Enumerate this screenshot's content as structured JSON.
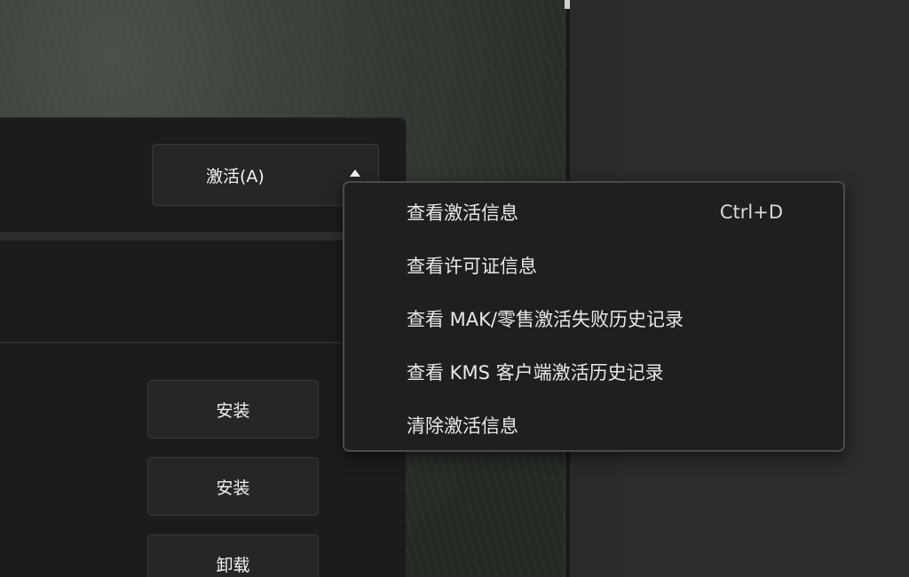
{
  "toolbar": {
    "activate_label": "激活(A)"
  },
  "actions": {
    "install_1_label": "安装",
    "install_2_label": "安装",
    "uninstall_label": "卸载"
  },
  "context_menu": {
    "items": [
      {
        "label": "查看激活信息",
        "shortcut": "Ctrl+D"
      },
      {
        "label": "查看许可证信息",
        "shortcut": ""
      },
      {
        "label": "查看 MAK/零售激活失败历史记录",
        "shortcut": ""
      },
      {
        "label": "查看 KMS 客户端激活历史记录",
        "shortcut": ""
      },
      {
        "label": "清除激活信息",
        "shortcut": ""
      }
    ]
  },
  "colors": {
    "menu_background": "#1f1f1f",
    "menu_border": "#4a4a4a",
    "panel_background": "#1c1c1c",
    "text": "#e8e8e8"
  },
  "icons": {
    "dropdown": "chevron-up-icon"
  }
}
